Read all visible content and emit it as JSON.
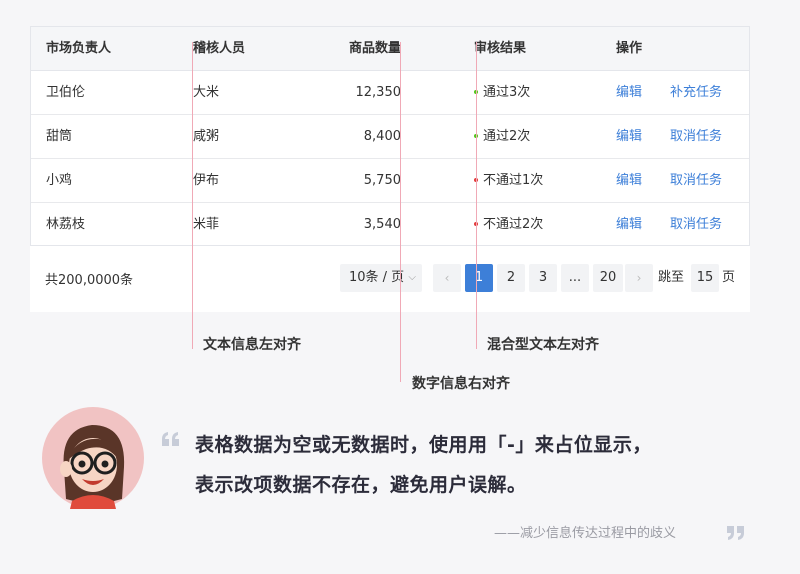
{
  "table": {
    "headers": {
      "market": "市场负责人",
      "reviewer": "稽核人员",
      "qty": "商品数量",
      "result": "审核结果",
      "op": "操作"
    },
    "rows": [
      {
        "market": "卫伯伦",
        "reviewer": "大米",
        "qty": "12,350",
        "result": "通过3次",
        "status_color": "#52c41a",
        "edit": "编辑",
        "task": "补充任务"
      },
      {
        "market": "甜筒",
        "reviewer": "咸粥",
        "qty": "8,400",
        "result": "通过2次",
        "status_color": "#52c41a",
        "edit": "编辑",
        "task": "取消任务"
      },
      {
        "market": "小鸡",
        "reviewer": "伊布",
        "qty": "5,750",
        "result": "不通过1次",
        "status_color": "#e23b3b",
        "edit": "编辑",
        "task": "取消任务"
      },
      {
        "market": "林荔枝",
        "reviewer": "米菲",
        "qty": "3,540",
        "result": "不通过2次",
        "status_color": "#e23b3b",
        "edit": "编辑",
        "task": "取消任务"
      }
    ]
  },
  "pagination": {
    "total": "共200,0000条",
    "page_size": "10条 / 页",
    "prev": "‹",
    "pages": [
      "1",
      "2",
      "3",
      "...",
      "20"
    ],
    "next": "›",
    "jump_label": "跳至",
    "jump_value": "15",
    "page_unit": "页"
  },
  "annotations": {
    "left_text": "文本信息左对齐",
    "right_number": "数字信息右对齐",
    "mixed_text": "混合型文本左对齐"
  },
  "quote": {
    "line1": "表格数据为空或无数据时，使用用「-」来占位显示，",
    "line2": "表示改项数据不存在，避免用户误解。",
    "source": "——减少信息传达过程中的歧义"
  },
  "colors": {
    "accent": "#3d7fd8",
    "pass": "#52c41a",
    "fail": "#e23b3b",
    "guide": "#f0a9b6"
  }
}
